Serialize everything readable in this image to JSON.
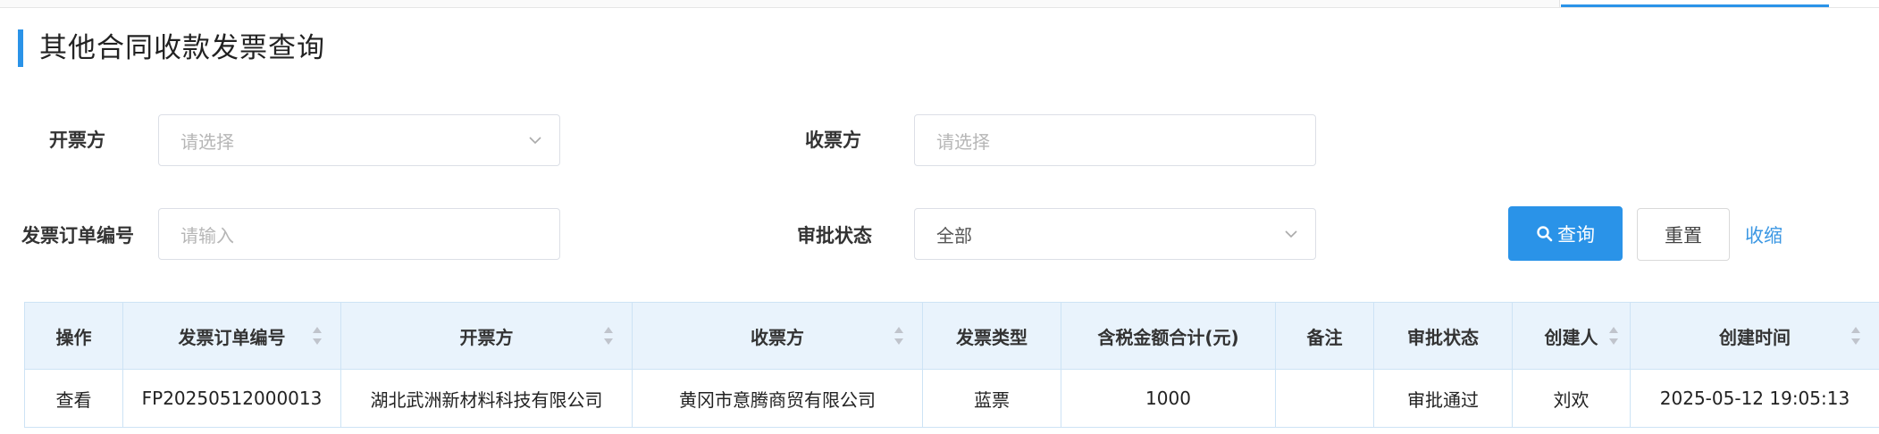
{
  "page": {
    "title": "其他合同收款发票查询"
  },
  "filters": {
    "issuer": {
      "label": "开票方",
      "placeholder": "请选择"
    },
    "receiver": {
      "label": "收票方",
      "placeholder": "请选择"
    },
    "order_no": {
      "label": "发票订单编号",
      "placeholder": "请输入"
    },
    "approval_status": {
      "label": "审批状态",
      "value": "全部"
    }
  },
  "actions": {
    "search": "查询",
    "reset": "重置",
    "collapse": "收缩"
  },
  "table": {
    "columns": [
      "操作",
      "发票订单编号",
      "开票方",
      "收票方",
      "发票类型",
      "含税金额合计(元)",
      "备注",
      "审批状态",
      "创建人",
      "创建时间"
    ],
    "rows": [
      {
        "action": "查看",
        "order_no": "FP20250512000013",
        "issuer": "湖北武洲新材料科技有限公司",
        "receiver": "黄冈市意腾商贸有限公司",
        "invoice_type": "蓝票",
        "amount": "1000",
        "remark": "",
        "status": "审批通过",
        "creator": "刘欢",
        "created_at": "2025-05-12 19:05:13"
      }
    ]
  },
  "colors": {
    "accent": "#2a93e8",
    "link": "#3b97e3",
    "header_bg": "#e9f3fc",
    "border": "#cde3f5"
  },
  "icons": {
    "search": "search-icon",
    "dropdown": "chevron-down-icon",
    "sort": "sort-icon"
  }
}
